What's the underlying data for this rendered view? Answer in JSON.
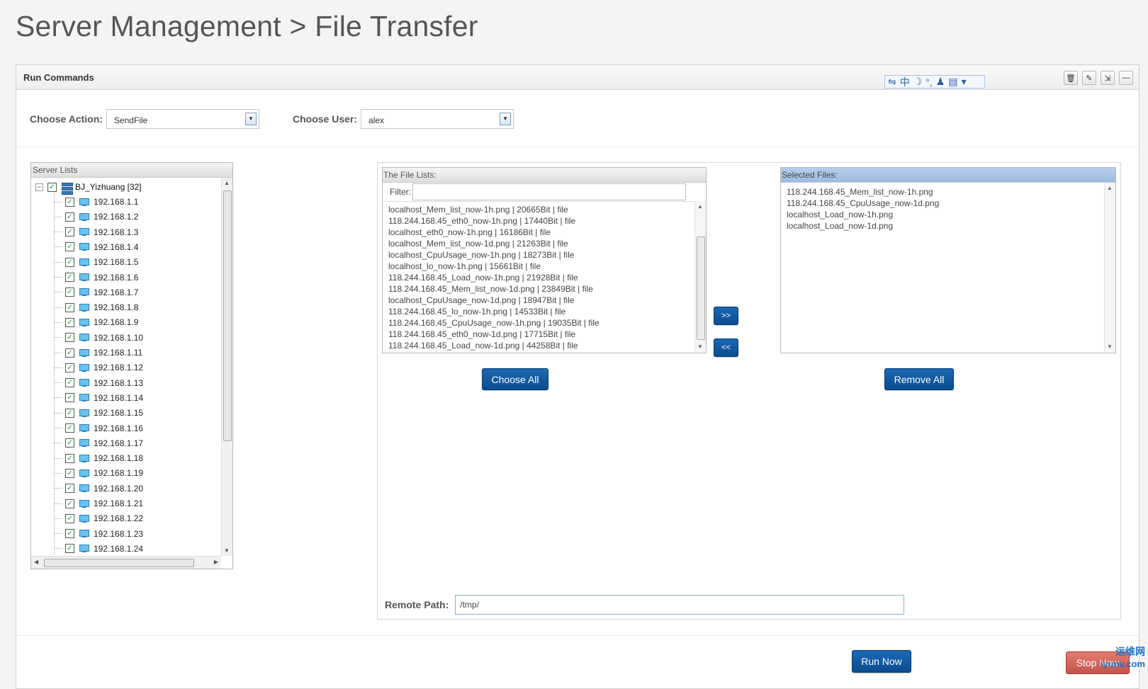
{
  "page": {
    "title": "Server Management > File Transfer"
  },
  "portlet": {
    "title": "Run Commands",
    "ime_label": "中",
    "tools": [
      "trash-icon",
      "eraser-icon",
      "expand-icon",
      "minimize-icon"
    ]
  },
  "form": {
    "action_label": "Choose Action:",
    "action_value": "SendFile",
    "user_label": "Choose User:",
    "user_value": "alex"
  },
  "server_list": {
    "header": "Server Lists",
    "root": "BJ_Yizhuang [32]",
    "items": [
      "192.168.1.1",
      "192.168.1.2",
      "192.168.1.3",
      "192.168.1.4",
      "192.168.1.5",
      "192.168.1.6",
      "192.168.1.7",
      "192.168.1.8",
      "192.168.1.9",
      "192.168.1.10",
      "192.168.1.11",
      "192.168.1.12",
      "192.168.1.13",
      "192.168.1.14",
      "192.168.1.15",
      "192.168.1.16",
      "192.168.1.17",
      "192.168.1.18",
      "192.168.1.19",
      "192.168.1.20",
      "192.168.1.21",
      "192.168.1.22",
      "192.168.1.23",
      "192.168.1.24"
    ]
  },
  "file_list": {
    "header": "The File Lists:",
    "filter_label": "Filter:",
    "filter_value": "",
    "items": [
      "localhost_Mem_list_now-1h.png | 20665Bit | file",
      "118.244.168.45_eth0_now-1h.png | 17440Bit | file",
      "localhost_eth0_now-1h.png | 16186Bit | file",
      "localhost_Mem_list_now-1d.png | 21263Bit | file",
      "localhost_CpuUsage_now-1h.png | 18273Bit | file",
      "localhost_lo_now-1h.png | 15661Bit | file",
      "118.244.168.45_Load_now-1h.png | 21928Bit | file",
      "118.244.168.45_Mem_list_now-1d.png | 23849Bit | file",
      "localhost_CpuUsage_now-1d.png | 18947Bit | file",
      "118.244.168.45_lo_now-1h.png | 14533Bit | file",
      "118.244.168.45_CpuUsage_now-1h.png | 19035Bit | file",
      "118.244.168.45_eth0_now-1d.png | 17715Bit | file",
      "118.244.168.45_Load_now-1d.png | 44258Bit | file"
    ],
    "choose_all": "Choose All"
  },
  "transfer": {
    "add": ">>",
    "remove": "<<"
  },
  "selected_files": {
    "header": "Selected Files:",
    "items": [
      "118.244.168.45_Mem_list_now-1h.png",
      "118.244.168.45_CpuUsage_now-1d.png",
      "localhost_Load_now-1h.png",
      "localhost_Load_now-1d.png"
    ],
    "remove_all": "Remove All"
  },
  "remote": {
    "label": "Remote Path:",
    "value": "/tmp/"
  },
  "actions": {
    "run": "Run Now",
    "stop": "Stop Now"
  },
  "watermark": {
    "line1": "运维网",
    "line2": "iyunv.com"
  },
  "colors": {
    "primary_button": "#0d5296",
    "stop_button": "#d0665b",
    "selected_header": "#a9c4e7"
  }
}
